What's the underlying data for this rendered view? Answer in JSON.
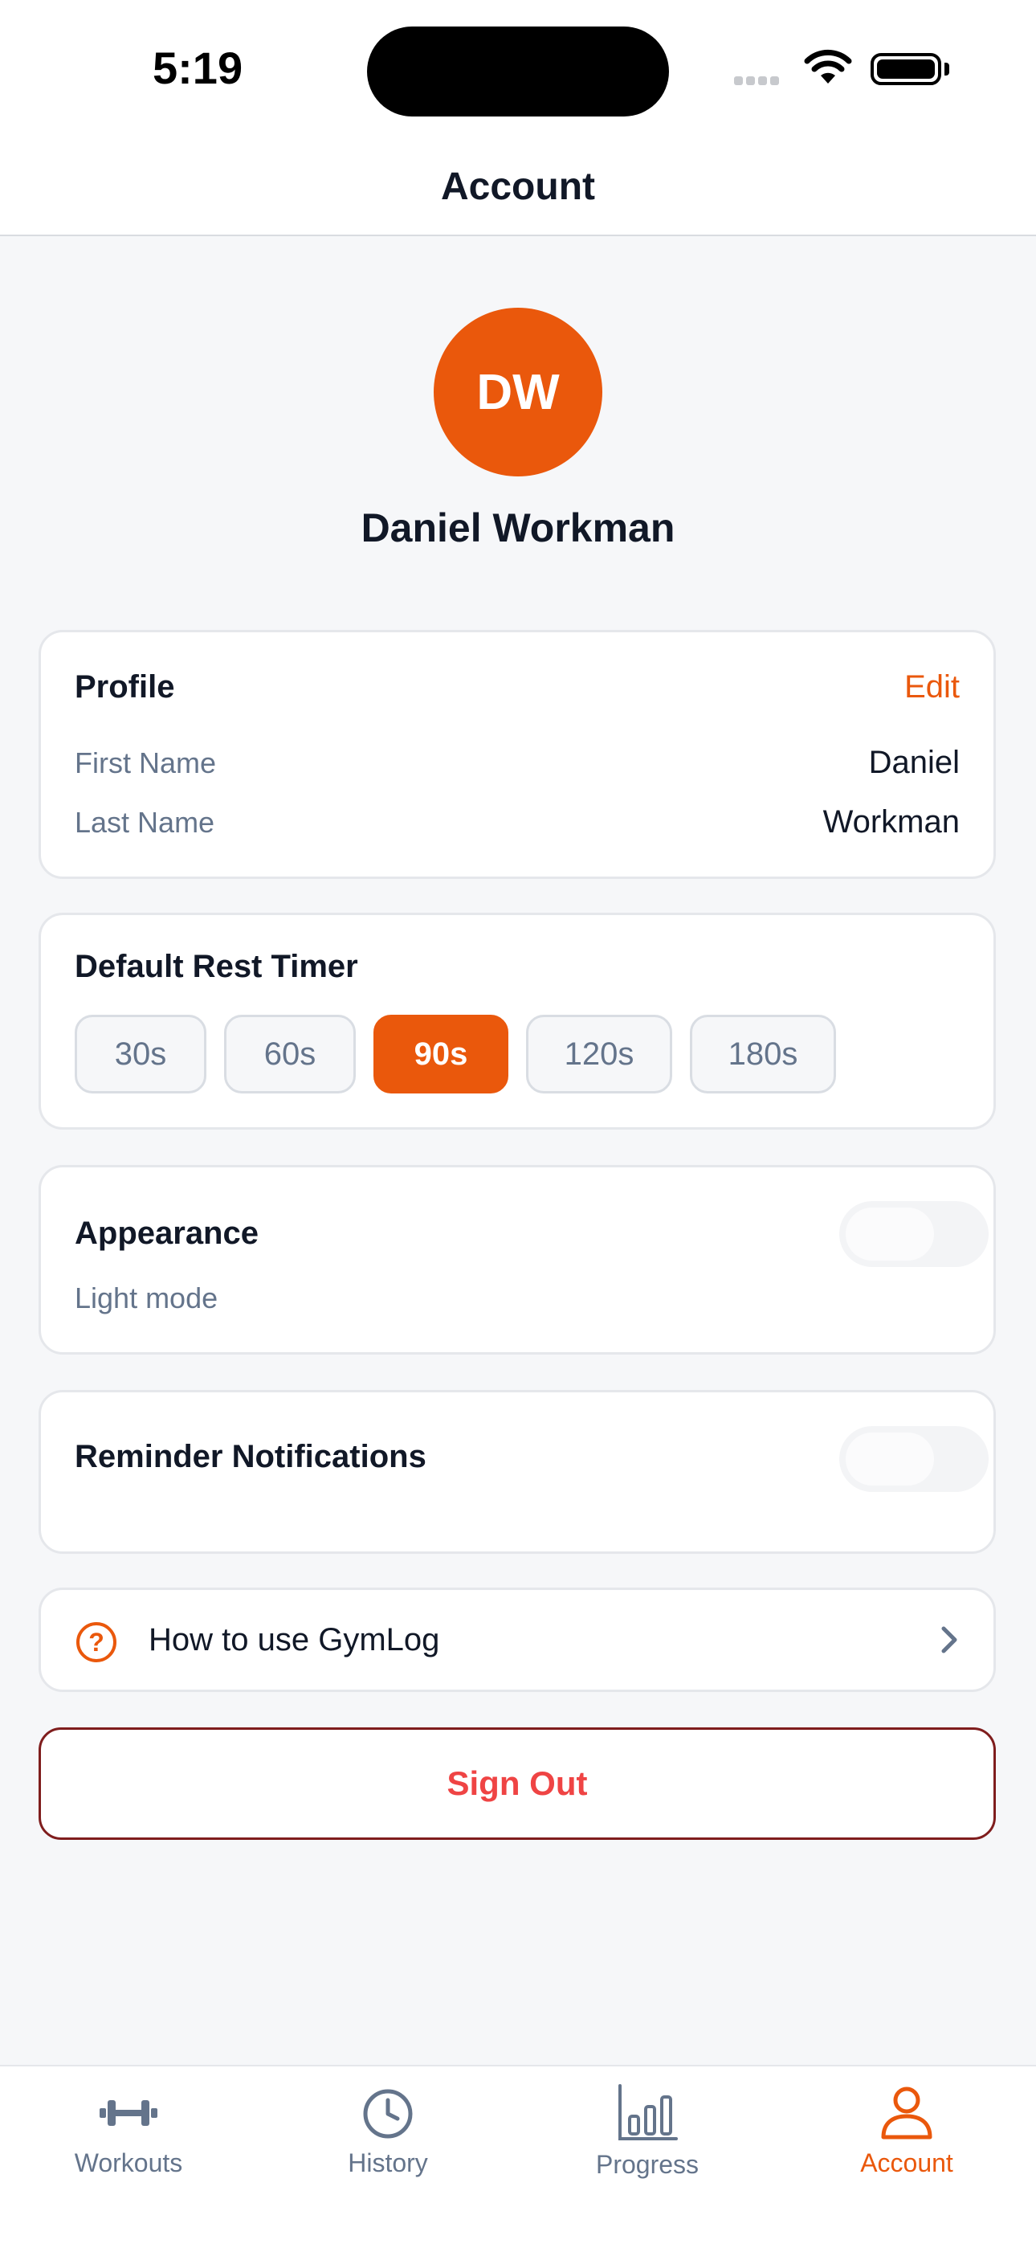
{
  "status_bar": {
    "time": "5:19"
  },
  "header": {
    "title": "Account"
  },
  "profile_header": {
    "initials": "DW",
    "name": "Daniel Workman"
  },
  "profile_card": {
    "title": "Profile",
    "edit_label": "Edit",
    "rows": [
      {
        "label": "First Name",
        "value": "Daniel"
      },
      {
        "label": "Last Name",
        "value": "Workman"
      }
    ]
  },
  "rest_timer": {
    "title": "Default Rest Timer",
    "options": [
      "30s",
      "60s",
      "90s",
      "120s",
      "180s"
    ],
    "selected": "90s"
  },
  "appearance": {
    "title": "Appearance",
    "subtitle": "Light mode",
    "toggle_on": false
  },
  "reminders": {
    "title": "Reminder Notifications",
    "toggle_on": false
  },
  "help": {
    "label": "How to use GymLog",
    "icon": "question-circle-icon"
  },
  "sign_out": {
    "label": "Sign Out"
  },
  "tab_bar": {
    "items": [
      {
        "label": "Workouts",
        "icon": "dumbbell-icon"
      },
      {
        "label": "History",
        "icon": "clock-icon"
      },
      {
        "label": "Progress",
        "icon": "bar-chart-icon"
      },
      {
        "label": "Account",
        "icon": "person-icon",
        "active": true
      }
    ]
  },
  "colors": {
    "accent": "#ea580c",
    "danger": "#ef4444",
    "danger_border": "#7f1d1d",
    "background": "#f6f7f9",
    "muted_text": "#64748b"
  }
}
